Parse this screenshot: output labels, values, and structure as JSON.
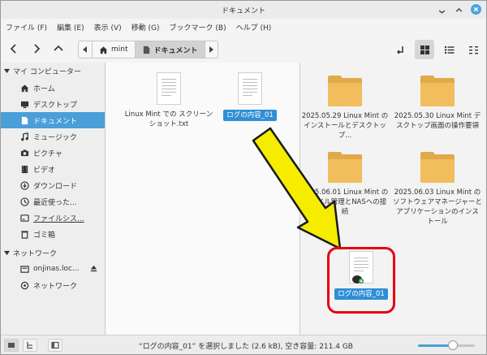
{
  "window": {
    "title": "ドキュメント"
  },
  "menu": [
    "ファイル (F)",
    "編集 (E)",
    "表示 (V)",
    "移動 (G)",
    "ブックマーク (B)",
    "ヘルプ (H)"
  ],
  "pathbar": {
    "home_label": "mint",
    "current_label": "ドキュメント"
  },
  "sidebar": {
    "section_computer": "マイ コンピューター",
    "items": [
      {
        "label": "ホーム",
        "icon": "home-icon"
      },
      {
        "label": "デスクトップ",
        "icon": "desktop-icon"
      },
      {
        "label": "ドキュメント",
        "icon": "document-icon",
        "selected": true
      },
      {
        "label": "ミュージック",
        "icon": "music-icon"
      },
      {
        "label": "ピクチャ",
        "icon": "camera-icon"
      },
      {
        "label": "ビデオ",
        "icon": "video-icon"
      },
      {
        "label": "ダウンロード",
        "icon": "download-icon"
      },
      {
        "label": "最近使った...",
        "icon": "recent-icon"
      },
      {
        "label": "ファイルシス...",
        "icon": "drive-icon"
      },
      {
        "label": "ゴミ箱",
        "icon": "trash-icon"
      }
    ],
    "section_network": "ネットワーク",
    "network_items": [
      {
        "label": "onjinas.loc...",
        "icon": "network-drive-icon"
      },
      {
        "label": "ネットワーク",
        "icon": "network-icon"
      }
    ]
  },
  "pane_left": {
    "files": [
      {
        "name": "Linux Mint での スクリーンショット.txt",
        "type": "text"
      },
      {
        "name": "ログの内容_01",
        "type": "text",
        "selected": true
      }
    ]
  },
  "pane_right": {
    "folders": [
      {
        "name": "2025.05.29 Linux Mint のインストールとデスクトップ..."
      },
      {
        "name": "2025.05.30 Linux Mint デスクトップ画面の操作要領"
      },
      {
        "name": "2025.06.01 Linux Mint のファイル管理とNASへの接続"
      },
      {
        "name": "2025.06.03 Linux Mint のソフトウェアマネージャーとアプリケーションのインストール"
      }
    ],
    "dragged_file": {
      "name": "ログの内容_01"
    }
  },
  "statusbar": {
    "text": "“ログの内容_01” を選択しました (2.6 kB), 空き容量: 211.4 GB",
    "zoom_level": 0.62
  },
  "colors": {
    "accent": "#4a9fd8",
    "annotation_red": "#e60012",
    "annotation_arrow": "#f5ec00"
  }
}
